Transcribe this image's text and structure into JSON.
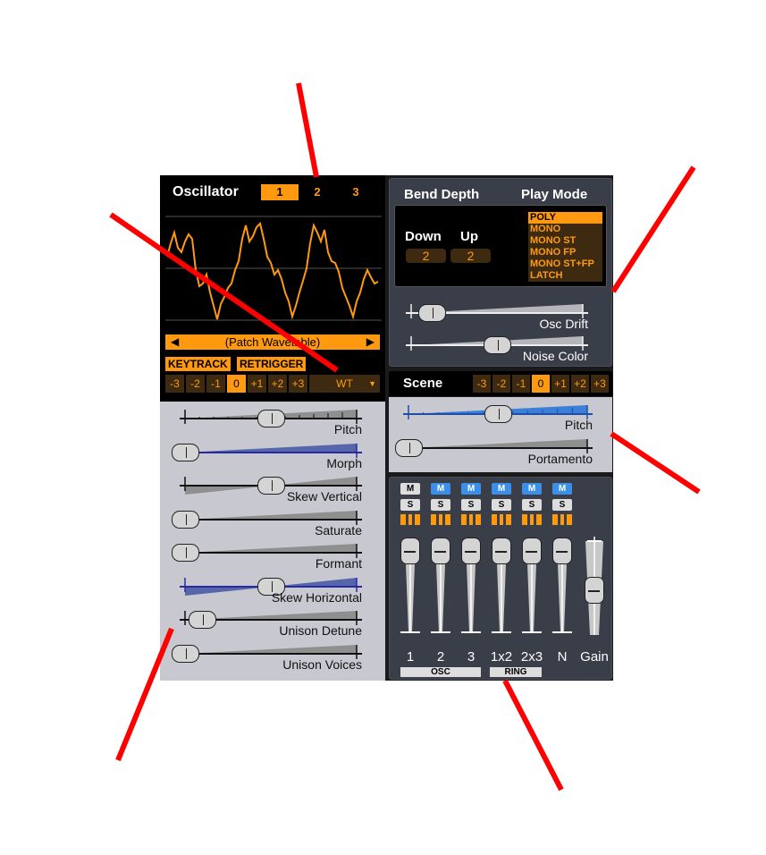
{
  "oscillator": {
    "title": "Oscillator",
    "tabs": [
      "1",
      "2",
      "3"
    ],
    "selected_tab": "1",
    "wavetable_name": "(Patch Wavetable)",
    "keytrack_label": "KEYTRACK",
    "retrigger_label": "RETRIGGER",
    "octave_buttons": [
      "-3",
      "-2",
      "-1",
      "0",
      "+1",
      "+2",
      "+3"
    ],
    "selected_octave": "0",
    "type_label": "WT"
  },
  "osc_sliders": [
    {
      "label": "Pitch",
      "value": 0.5
    },
    {
      "label": "Morph",
      "value": 0.0
    },
    {
      "label": "Skew Vertical",
      "value": 0.5
    },
    {
      "label": "Saturate",
      "value": 0.0
    },
    {
      "label": "Formant",
      "value": 0.0
    },
    {
      "label": "Skew Horizontal",
      "value": 0.5
    },
    {
      "label": "Unison Detune",
      "value": 0.1
    },
    {
      "label": "Unison Voices",
      "value": 0.0
    }
  ],
  "bend": {
    "title": "Bend Depth",
    "down_label": "Down",
    "up_label": "Up",
    "down_value": "2",
    "up_value": "2"
  },
  "play_mode": {
    "title": "Play Mode",
    "options": [
      "POLY",
      "MONO",
      "MONO ST",
      "MONO FP",
      "MONO ST+FP",
      "LATCH"
    ],
    "selected": "POLY"
  },
  "global_sliders": [
    {
      "label": "Osc Drift",
      "value": 0.12
    },
    {
      "label": "Noise Color",
      "value": 0.5
    }
  ],
  "scene": {
    "title": "Scene",
    "octave_buttons": [
      "-3",
      "-2",
      "-1",
      "0",
      "+1",
      "+2",
      "+3"
    ],
    "selected_octave": "0",
    "sliders": [
      {
        "label": "Pitch",
        "value": 0.5
      },
      {
        "label": "Portamento",
        "value": 0.0
      }
    ]
  },
  "mixer": {
    "channels": [
      {
        "label": "1",
        "mute": "M",
        "solo": "S",
        "muted": false,
        "value": 0.92
      },
      {
        "label": "2",
        "mute": "M",
        "solo": "S",
        "muted": true,
        "value": 0.92
      },
      {
        "label": "3",
        "mute": "M",
        "solo": "S",
        "muted": true,
        "value": 0.92
      },
      {
        "label": "1x2",
        "mute": "M",
        "solo": "S",
        "muted": true,
        "value": 0.92
      },
      {
        "label": "2x3",
        "mute": "M",
        "solo": "S",
        "muted": true,
        "value": 0.92
      },
      {
        "label": "N",
        "mute": "M",
        "solo": "S",
        "muted": true,
        "value": 0.92
      }
    ],
    "gain_label": "Gain",
    "gain_value": 0.5,
    "osc_group_label": "OSC",
    "ring_group_label": "RING"
  },
  "colors": {
    "accent": "#ff9a10",
    "annotation": "#ff0000",
    "mute_active": "#3b8fe8"
  }
}
